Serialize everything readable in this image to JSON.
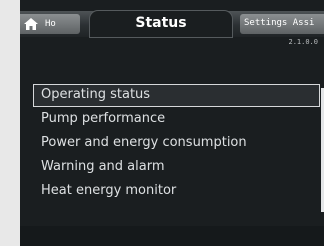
{
  "tabs": {
    "home_label": "Ho",
    "status_label": "Status",
    "settings_label": "Settings Assi"
  },
  "version": "2.1.0.0",
  "menu": {
    "items": [
      {
        "label": "Operating status",
        "selected": true
      },
      {
        "label": "Pump performance",
        "selected": false
      },
      {
        "label": "Power and energy consumption",
        "selected": false
      },
      {
        "label": "Warning and alarm",
        "selected": false
      },
      {
        "label": "Heat energy monitor",
        "selected": false
      }
    ]
  },
  "colors": {
    "background": "#1a1e20",
    "selection_border": "#d6d8da",
    "text": "#dde0e2"
  }
}
